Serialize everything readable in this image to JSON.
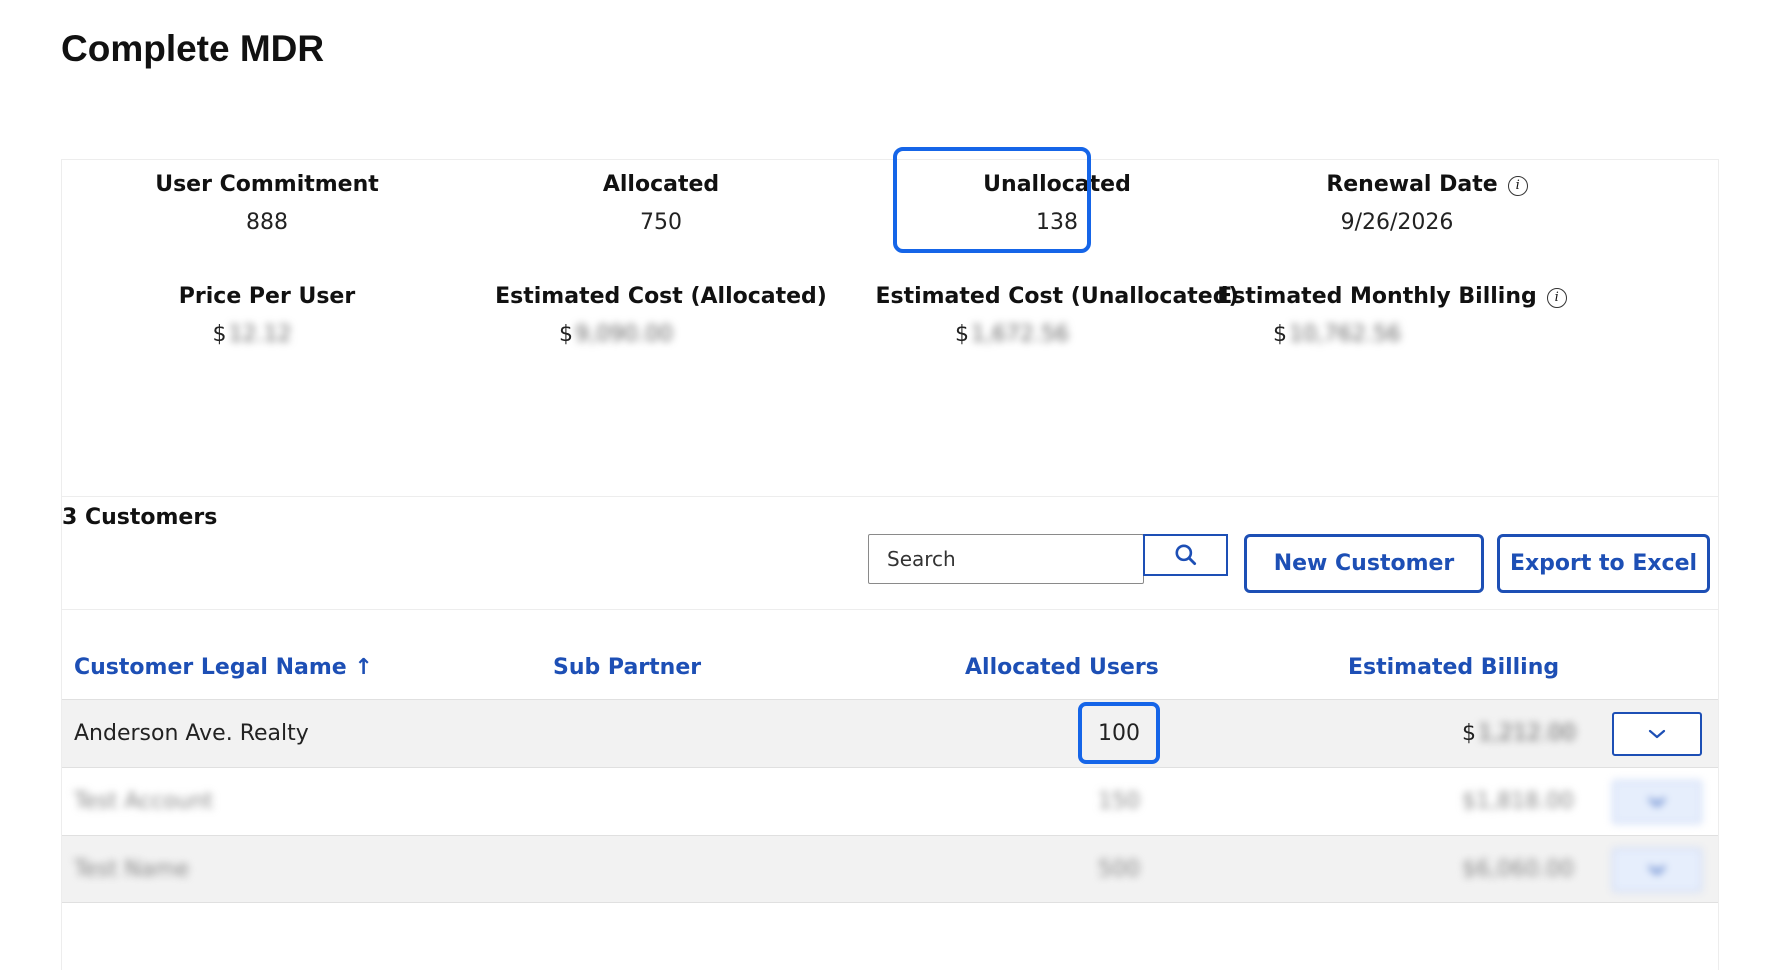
{
  "page": {
    "title": "Complete MDR"
  },
  "summary": {
    "user_commitment": {
      "label": "User Commitment",
      "value": "888"
    },
    "allocated": {
      "label": "Allocated",
      "value": "750"
    },
    "unallocated": {
      "label": "Unallocated",
      "value": "138"
    },
    "renewal_date": {
      "label": "Renewal Date",
      "value": "9/26/2026",
      "info_icon": "i"
    },
    "price_per_user": {
      "label": "Price Per User",
      "currency": "$",
      "value": "12.12"
    },
    "est_cost_allocated": {
      "label": "Estimated Cost (Allocated)",
      "currency": "$",
      "value": "9,090.00"
    },
    "est_cost_unallocated": {
      "label": "Estimated Cost (Unallocated)",
      "currency": "$",
      "value": "1,672.56"
    },
    "est_monthly_billing": {
      "label": "Estimated Monthly Billing",
      "currency": "$",
      "value": "10,762.56",
      "info_icon": "i"
    }
  },
  "customers": {
    "count_label": "3 Customers",
    "search_placeholder": "Search",
    "new_customer_label": "New Customer",
    "export_label": "Export to Excel",
    "columns": {
      "legal_name": "Customer Legal Name",
      "sort_indicator": "↑",
      "sub_partner": "Sub Partner",
      "allocated_users": "Allocated Users",
      "estimated_billing": "Estimated Billing"
    },
    "rows": [
      {
        "name": "Anderson Ave. Realty",
        "sub_partner": "",
        "users": "100",
        "currency": "$",
        "billing": "1,212.00"
      },
      {
        "name": "Test Account",
        "sub_partner": "",
        "users": "150",
        "currency": "$",
        "billing": "1,818.00"
      },
      {
        "name": "Test Name",
        "sub_partner": "",
        "users": "500",
        "currency": "$",
        "billing": "6,060.00"
      }
    ]
  },
  "colors": {
    "accent": "#1d4fb5",
    "highlight": "#1565e8"
  },
  "icons": {
    "search": "search-icon",
    "expand": "chevron-down-icon",
    "info": "info-icon"
  }
}
